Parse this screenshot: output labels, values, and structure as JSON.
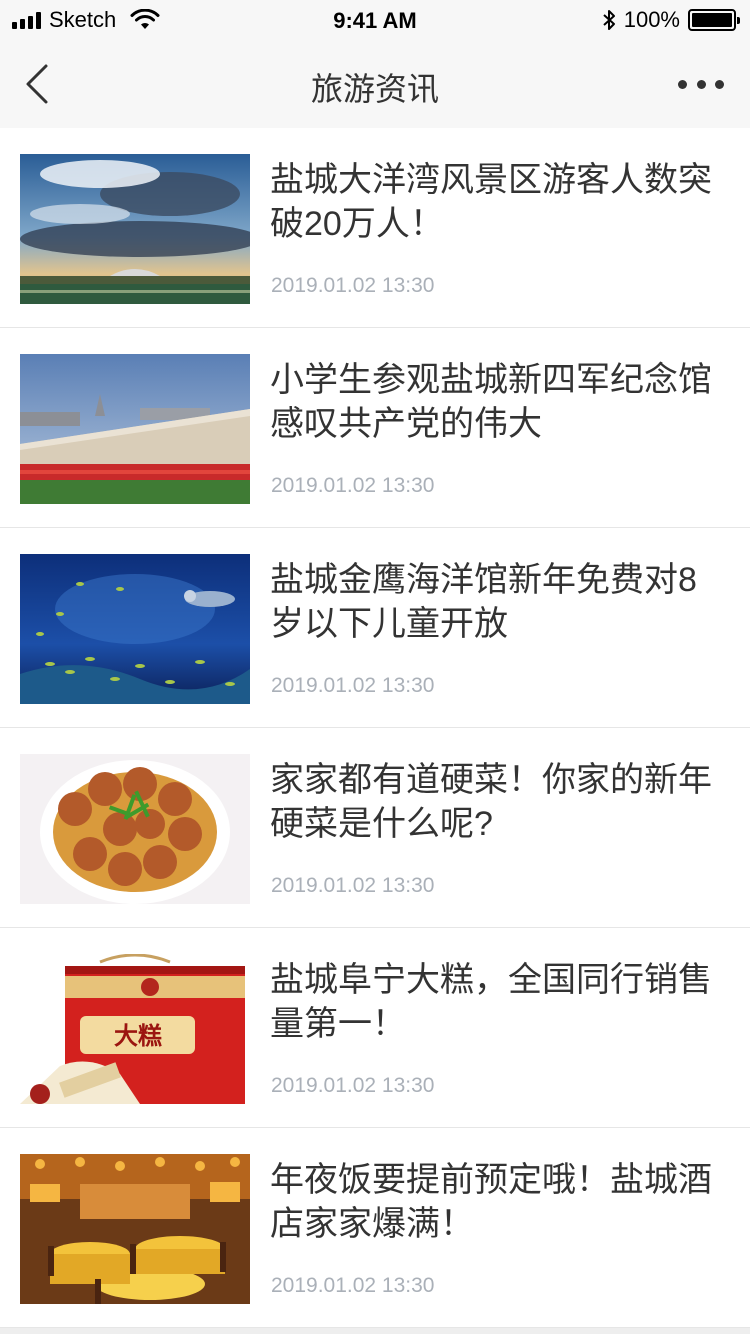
{
  "status_bar": {
    "carrier": "Sketch",
    "time": "9:41 AM",
    "battery": "100%",
    "battery_level": 1.0,
    "icons": [
      "signal-icon",
      "wifi-icon",
      "bluetooth-icon",
      "battery-icon"
    ]
  },
  "nav": {
    "title": "旅游资讯",
    "back_icon": "chevron-left-icon",
    "more_icon": "more-icon"
  },
  "articles": [
    {
      "title": "盐城大洋湾风景区游客人数突破20万人！",
      "time": "2019.01.02 13:30",
      "image": "sky-landscape-photo"
    },
    {
      "title": "小学生参观盐城新四军纪念馆感叹共产党的伟大",
      "time": "2019.01.02 13:30",
      "image": "memorial-wall-photo"
    },
    {
      "title": "盐城金鹰海洋馆新年免费对8岁以下儿童开放",
      "time": "2019.01.02 13:30",
      "image": "aquarium-photo"
    },
    {
      "title": "家家都有道硬菜！你家的新年硬菜是什么呢?",
      "time": "2019.01.02 13:30",
      "image": "meatball-dish-photo"
    },
    {
      "title": "盐城阜宁大糕，全国同行销售量第一！",
      "time": "2019.01.02 13:30",
      "image": "cake-giftbox-photo",
      "image_text": "大糕"
    },
    {
      "title": "年夜饭要提前预定哦！盐城酒店家家爆满！",
      "time": "2019.01.02 13:30",
      "image": "restaurant-hall-photo"
    }
  ]
}
